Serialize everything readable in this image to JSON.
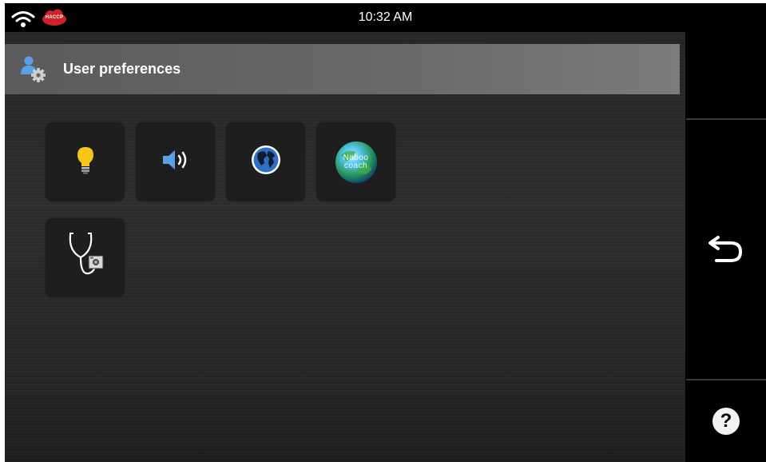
{
  "status_bar": {
    "time": "10:32 AM",
    "wifi_icon": "wifi-icon",
    "haccp_badge": "HACCP",
    "haccp_color": "#d0202a"
  },
  "header": {
    "title": "User preferences",
    "icon": "user-settings-icon"
  },
  "tiles": [
    {
      "name": "brightness",
      "icon": "lightbulb-icon"
    },
    {
      "name": "sound",
      "icon": "speaker-icon"
    },
    {
      "name": "language",
      "icon": "globe-icon"
    },
    {
      "name": "naboo-coach",
      "icon": "naboo-coach-globe-icon",
      "text": "Naboo coach"
    },
    {
      "name": "diagnostics",
      "icon": "stethoscope-icon"
    }
  ],
  "sidebar": {
    "back_icon": "back-arrow-icon",
    "help_label": "?"
  },
  "colors": {
    "accent_blue": "#5aa0e6",
    "lightbulb_yellow": "#f5c518"
  }
}
